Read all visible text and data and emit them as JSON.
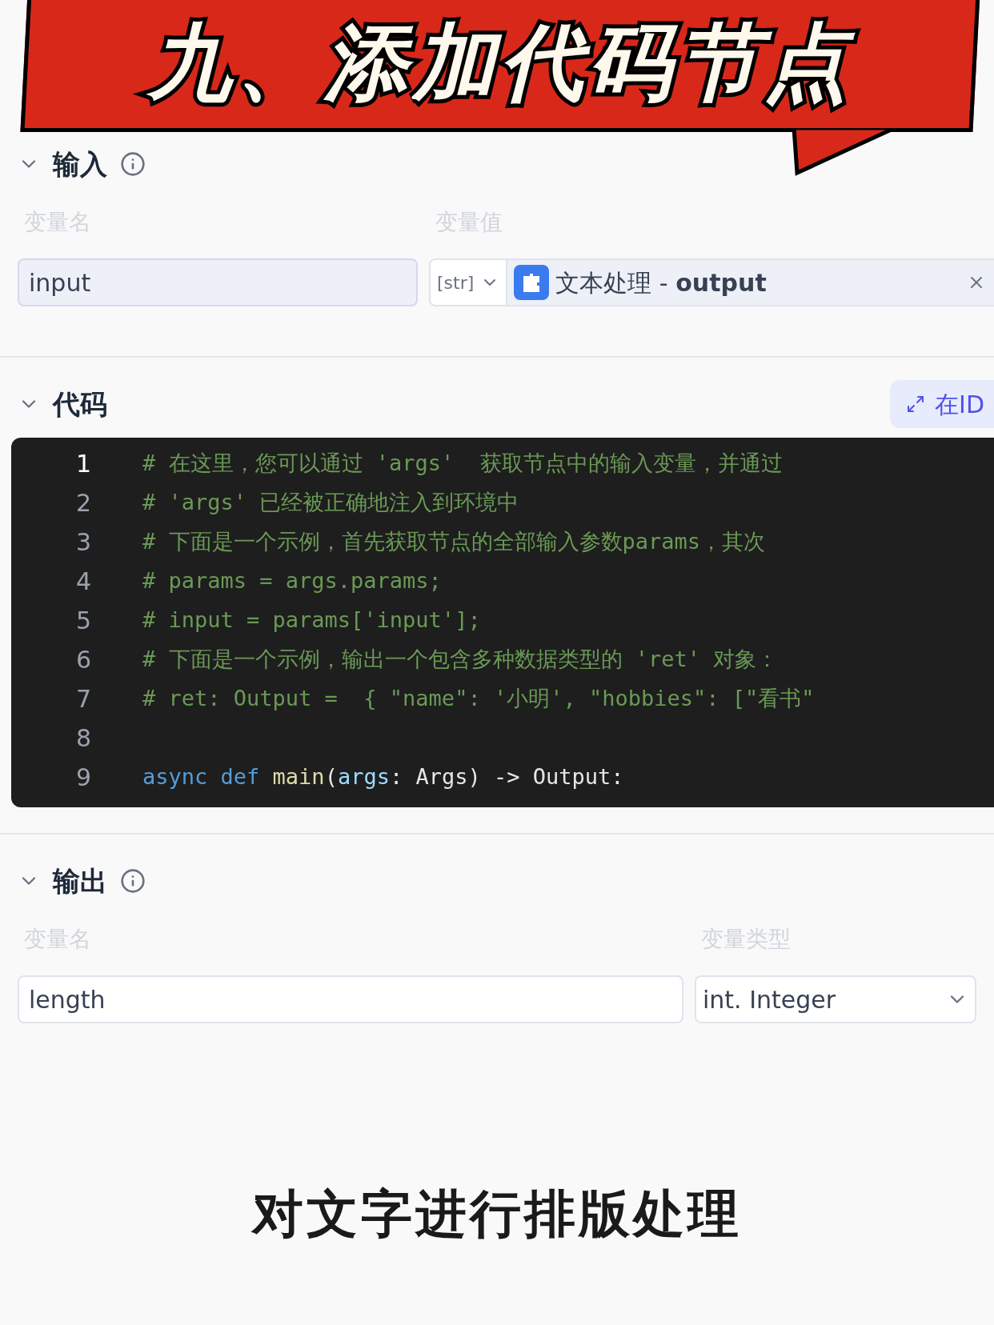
{
  "banner": {
    "title": "九、添加代码节点"
  },
  "input_section": {
    "title": "输入",
    "expanded": true,
    "columns": [
      "变量名",
      "变量值"
    ],
    "rows": [
      {
        "name": "input",
        "type_tag": "[str]",
        "source": "文本处理",
        "separator": "-",
        "output": "output"
      }
    ]
  },
  "code_section": {
    "title": "代码",
    "expanded": true,
    "ide_button": "在ID",
    "lines": [
      {
        "number": "1",
        "kind": "comment",
        "text": "# 在这里，您可以通过 'args'  获取节点中的输入变量，并通过"
      },
      {
        "number": "2",
        "kind": "comment",
        "text": "# 'args' 已经被正确地注入到环境中"
      },
      {
        "number": "3",
        "kind": "comment",
        "text": "# 下面是一个示例，首先获取节点的全部输入参数params，其次"
      },
      {
        "number": "4",
        "kind": "comment",
        "text": "# params = args.params;"
      },
      {
        "number": "5",
        "kind": "comment",
        "text": "# input = params['input'];"
      },
      {
        "number": "6",
        "kind": "comment",
        "text": "# 下面是一个示例，输出一个包含多种数据类型的 'ret' 对象："
      },
      {
        "number": "7",
        "kind": "comment",
        "text": "# ret: Output =  { \"name\": '小明', \"hobbies\": [\"看书\""
      },
      {
        "number": "8",
        "kind": "blank"
      },
      {
        "number": "9",
        "kind": "def",
        "tokens": [
          "async",
          "def",
          "main",
          "(",
          "args",
          ": ",
          "Args",
          ") -> ",
          "Output",
          ":"
        ]
      }
    ]
  },
  "output_section": {
    "title": "输出",
    "expanded": true,
    "columns": [
      "变量名",
      "变量类型"
    ],
    "rows": [
      {
        "name": "length",
        "type": "int. Integer"
      }
    ]
  },
  "caption": "对文字进行排版处理"
}
